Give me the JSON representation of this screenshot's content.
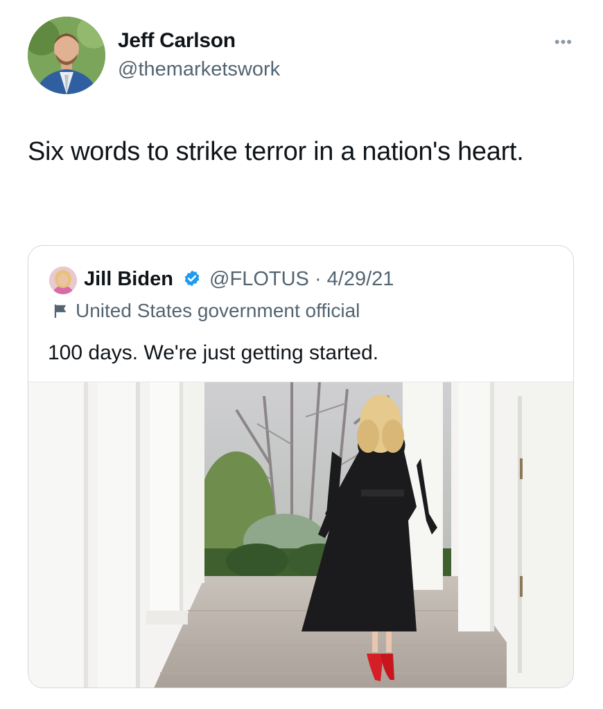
{
  "tweet": {
    "author": {
      "name": "Jeff Carlson",
      "handle": "@themarketswork"
    },
    "more_label": "•••",
    "text": "Six words to strike terror in a nation's heart."
  },
  "quote": {
    "author": {
      "name": "Jill Biden",
      "handle": "@FLOTUS",
      "date": "4/29/21",
      "separator": " · "
    },
    "label": "United States government official",
    "text": "100 days. We're just getting started."
  },
  "icons": {
    "verified": "verified-badge-icon",
    "flag": "flag-icon",
    "more": "more-options-icon"
  },
  "colors": {
    "verified": "#1d9bf0",
    "secondary_text": "#536471",
    "border": "#cfd9de"
  }
}
